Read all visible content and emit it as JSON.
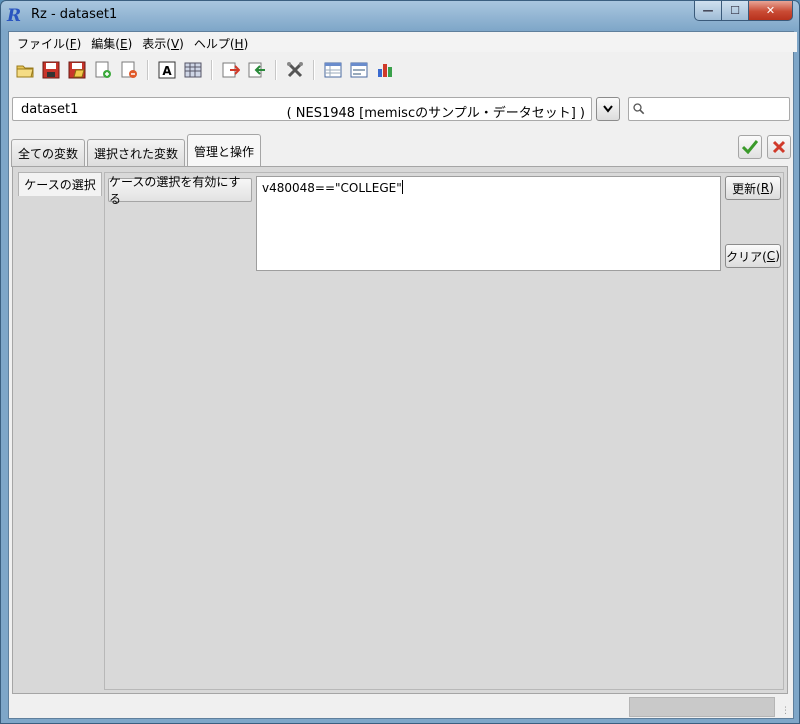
{
  "window": {
    "title": "Rz - dataset1",
    "app_icon": "R"
  },
  "menubar": {
    "items": [
      {
        "label": "ファイル(",
        "key": "F",
        "tail": ")"
      },
      {
        "label": "編集(",
        "key": "E",
        "tail": ")"
      },
      {
        "label": "表示(",
        "key": "V",
        "tail": ")"
      },
      {
        "label": "ヘルプ(",
        "key": "H",
        "tail": ")"
      }
    ]
  },
  "toolbar": {
    "icons": [
      "open-folder-icon",
      "save-icon",
      "save-as-icon",
      "import-icon",
      "export-icon",
      "text-icon",
      "grid-icon",
      "add-row-icon",
      "remove-row-icon",
      "tools-icon",
      "variable-view-icon",
      "data-view-icon",
      "bar-chart-icon"
    ]
  },
  "dataset": {
    "name": "dataset1",
    "description": "( NES1948 [memiscのサンプル・データセット] )"
  },
  "search": {
    "placeholder": ""
  },
  "tabs": [
    "全ての変数",
    "選択された変数",
    "管理と操作"
  ],
  "active_tab": 2,
  "panel": {
    "subtab": "ケースの選択",
    "enable_button": "ケースの選択を有効にする",
    "filter_expression": "v480048==\"COLLEGE\"",
    "update_button": {
      "label": "更新(",
      "key": "R",
      "tail": ")"
    },
    "clear_button": {
      "label": "クリア(",
      "key": "C",
      "tail": ")"
    }
  },
  "colors": {
    "ok": "#3a9a2a",
    "cancel": "#d03a2a",
    "close_button": "#c94b34"
  }
}
